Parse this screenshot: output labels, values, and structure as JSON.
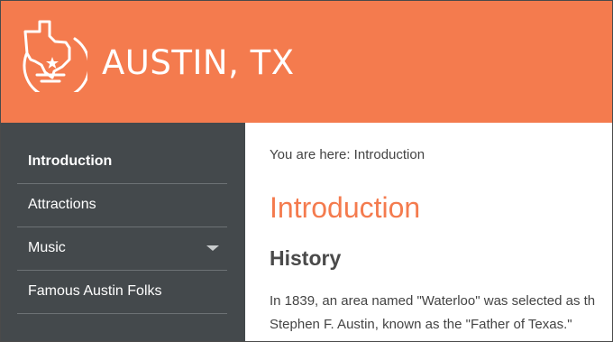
{
  "header": {
    "title": "AUSTIN, TX",
    "logo_icon": "texas-star-logo-icon",
    "bg_color": "#f47b4e"
  },
  "sidebar": {
    "bg_color": "#44494c",
    "items": [
      {
        "label": "Introduction",
        "active": true
      },
      {
        "label": "Attractions",
        "active": false
      },
      {
        "label": "Music",
        "active": false,
        "has_submenu": true,
        "submenu_icon": "caret-down-icon"
      },
      {
        "label": "Famous Austin Folks",
        "active": false
      }
    ]
  },
  "main": {
    "breadcrumb": "You are here: Introduction",
    "page_title": "Introduction",
    "accent_color": "#f47b4e",
    "section_heading": "History",
    "paragraph_lines": [
      "In 1839, an area named \"Waterloo\" was selected as th",
      "Stephen F. Austin, known as the \"Father of Texas.\""
    ]
  }
}
